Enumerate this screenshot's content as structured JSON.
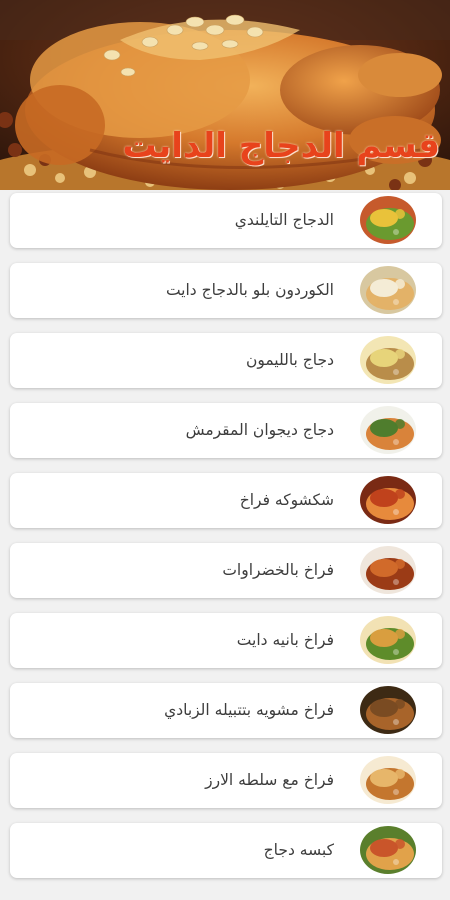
{
  "header": {
    "title": "قسم الدجاج الدايت",
    "image_icon": "roast-chicken-image"
  },
  "recipes": [
    {
      "title": "الدجاج التايلندي",
      "thumb": "food-thumbnail",
      "colors": [
        "#e9c23a",
        "#6a9a2f",
        "#c65a2c"
      ]
    },
    {
      "title": "الكوردون بلو بالدجاج دايت",
      "thumb": "food-thumbnail",
      "colors": [
        "#f4ecd6",
        "#e3b268",
        "#d8c8a0"
      ]
    },
    {
      "title": "دجاج بالليمون",
      "thumb": "food-thumbnail",
      "colors": [
        "#e7d47a",
        "#b98d4a",
        "#f3e6b4"
      ]
    },
    {
      "title": "دجاج ديجوان المقرمش",
      "thumb": "food-thumbnail",
      "colors": [
        "#4f7d2d",
        "#d9833a",
        "#f1f1ea"
      ]
    },
    {
      "title": "شكشوكه فراخ",
      "thumb": "food-thumbnail",
      "colors": [
        "#c0421c",
        "#e78a3c",
        "#7a2a14"
      ]
    },
    {
      "title": "فراخ بالخضراوات",
      "thumb": "food-thumbnail",
      "colors": [
        "#d16a2a",
        "#9b3b16",
        "#efe6dc"
      ]
    },
    {
      "title": "فراخ بانيه دايت",
      "thumb": "food-thumbnail",
      "colors": [
        "#d99e3f",
        "#5e8c2a",
        "#f2e2b4"
      ]
    },
    {
      "title": "فراخ مشويه بتتبيله الزبادي",
      "thumb": "food-thumbnail",
      "colors": [
        "#7a4b22",
        "#a8642a",
        "#3d2a14"
      ]
    },
    {
      "title": "فراخ مع سلطه الارز",
      "thumb": "food-thumbnail",
      "colors": [
        "#e7b66a",
        "#c4762e",
        "#f6ead2"
      ]
    },
    {
      "title": "كبسه دجاج",
      "thumb": "food-thumbnail",
      "colors": [
        "#c9552a",
        "#e1a24a",
        "#5a7f2c"
      ]
    }
  ]
}
